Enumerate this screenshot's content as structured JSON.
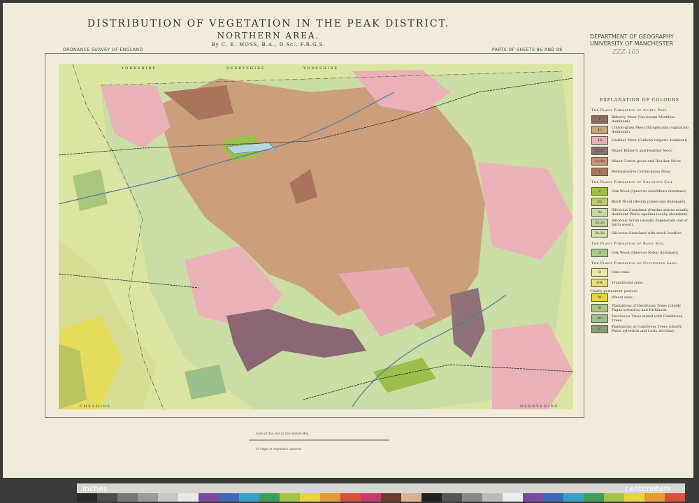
{
  "title": {
    "line1": "DISTRIBUTION OF VEGETATION IN THE PEAK DISTRICT.",
    "line2": "NORTHERN AREA.",
    "author": "By C. E. MOSS, B.A., D.Sc., F.R.G.S."
  },
  "department": {
    "line1": "DEPARTMENT OF GEOGRAPHY",
    "line2": "UNIVERSITY OF MANCHESTER",
    "pencil": "ZZZ-105"
  },
  "survey_label": "ORDNANCE SURVEY OF ENGLAND",
  "sheets_label": "PARTS OF SHEETS 86 AND 98",
  "legend": {
    "heading": "EXPLANATION OF COLOURS",
    "sections": [
      {
        "title": "The Plant Formation of Acidic Peat",
        "items": [
          {
            "code": "1",
            "color": "#8c6a63",
            "label": "Bilberry Moor (Vaccinium Myrtillus dominant)."
          },
          {
            "code": "1c",
            "color": "#c9a57e",
            "label": "Cotton-grass Moor (Eriophorum vaginatum dominant)."
          },
          {
            "code": "1h",
            "color": "#eaaeb6",
            "label": "Heather Moor (Calluna vulgaris dominant)."
          },
          {
            "code": "1v.1c",
            "color": "#8e7278",
            "label": "Mixed Bilberry and Heather Moor."
          },
          {
            "code": "1c.1h",
            "color": "#c79276",
            "label": "Mixed Cotton-grass and Heather Moor."
          },
          {
            "code": "1",
            "color": "#a9735c",
            "label": "Retrogressive Cotton-grass Moor."
          }
        ]
      },
      {
        "title": "The Plant Formation of Siliceous Soil",
        "items": [
          {
            "code": "2",
            "color": "#9bbf4a",
            "label": "Oak Wood (Quercus sessiliflora dominant)."
          },
          {
            "code": "2b",
            "color": "#b7cc6e",
            "label": "Birch Wood (Betula pubescens dominant)."
          },
          {
            "code": "2s",
            "color": "#c6dba0",
            "label": "Siliceous Grassland (Nardus stricta usually dominant Pteris aquilina locally abundant)."
          },
          {
            "code": "2s.2o",
            "color": "#bfd49a",
            "label": "Siliceous Scrub (usually degenerate oak or birch wood)."
          },
          {
            "code": "2s.1h",
            "color": "#d4dcb2",
            "label": "Siliceous Grassland with much heather."
          }
        ]
      },
      {
        "title": "The Plant Formation of Basic Soil",
        "items": [
          {
            "code": "3",
            "color": "#a7c98c",
            "label": "Oak Wood (Quercus Robur dominant)."
          }
        ]
      },
      {
        "title": "The Plant Formation of Cultivated Land",
        "items": [
          {
            "code": "O",
            "color": "#e9e89e",
            "label": "Oats zone."
          },
          {
            "code": "OW",
            "color": "#e6e07a",
            "label": "Transitional zone."
          },
          {
            "code": "W",
            "color": "#e8d24a",
            "label": "Wheat zone."
          },
          {
            "code": "D",
            "color": "#a9c77c",
            "label": "Plantations of Deciduous Trees (chiefly Fagus sylvatica) and Parklands."
          },
          {
            "code": "DC",
            "color": "#9bbf8a",
            "label": "Deciduous Trees mixed with Coniferous Trees."
          },
          {
            "code": "C",
            "color": "#8f9c78",
            "label": "Plantations of Coniferous Trees (chiefly Pinus sylvestris and Larix decidua)."
          }
        ]
      }
    ],
    "brace_note": "Chiefly permanent pasture"
  },
  "map_county_labels": [
    "YORKSHIRE",
    "DERBYSHIRE",
    "YORKSHIRE",
    "CHESHIRE",
    "DERBYSHIRE"
  ],
  "bottom": {
    "scale": "Scale of One Inch to One Statute Mile",
    "note": "All edges of vegetation coloured."
  },
  "strip": {
    "left_word": "inches",
    "right_word": "centimeters",
    "chip_colors": [
      "#2a2a2a",
      "#4d4d4d",
      "#777",
      "#9a9a9a",
      "#c7c7c7",
      "#e8e8e8",
      "#7a4aa0",
      "#3d6ab7",
      "#38a0c8",
      "#3f9d5c",
      "#a2c444",
      "#e7d53b",
      "#e59a35",
      "#d5513a",
      "#c23d6e",
      "#6b3e2c",
      "#d9b48e",
      "#222",
      "#555",
      "#888",
      "#bbb",
      "#eee",
      "#7a4aa0",
      "#3d6ab7",
      "#38a0c8",
      "#3f9d5c",
      "#a2c444",
      "#e7d53b",
      "#e59a35",
      "#d5513a"
    ]
  }
}
